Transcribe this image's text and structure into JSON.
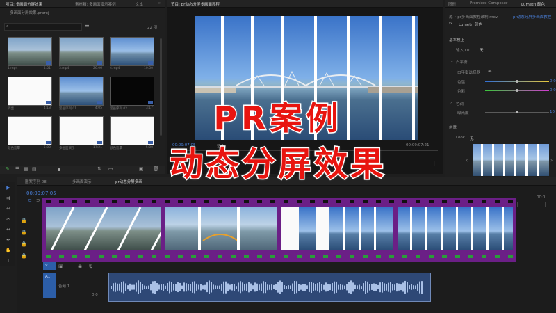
{
  "project_panel": {
    "tabs": [
      "项目: 多画面分屏效果",
      "素材箱: 多画面演示案例",
      "文本"
    ],
    "file_name": "多画面分屏效果.prproj",
    "item_count": "22 项",
    "clips": [
      {
        "label": "1.mp4",
        "duration": "4:01",
        "kind": "city"
      },
      {
        "label": "3.mp4",
        "duration": "26:06",
        "kind": "city"
      },
      {
        "label": "4.mp4",
        "duration": "10:50",
        "kind": "bridge"
      },
      {
        "label": "调出",
        "duration": "4:13",
        "kind": "white"
      },
      {
        "label": "竖画序列 01",
        "duration": "4:05",
        "kind": "bridge"
      },
      {
        "label": "竖画序列 02",
        "duration": "3:17",
        "kind": "black"
      },
      {
        "label": "颜色遮罩",
        "duration": "5:00",
        "kind": "white"
      },
      {
        "label": "多画面演示",
        "duration": "17:21",
        "kind": "white"
      },
      {
        "label": "颜色遮罩",
        "duration": "5:00",
        "kind": "white"
      }
    ]
  },
  "program_monitor": {
    "tab": "节目: pr动态分屏多画面教程",
    "timecode_left": "00:09:07:05",
    "fit_label": "适合",
    "timecode_right": "00:09:07:21"
  },
  "right_panel": {
    "tabs": [
      "图形",
      "Premiere Composer",
      "Lumetri 颜色"
    ],
    "source_line": "源 • pr多画面教程录制.mov",
    "sequence_line": "pr动态分屏多画面教程",
    "effect_name": "Lumetri 颜色",
    "basic_correction": "基本校正",
    "input_lut_label": "输入 LUT",
    "input_lut_value": "无",
    "white_balance": "白平衡",
    "wb_picker": "白平衡选择器",
    "temperature": "色温",
    "tint": "色彩",
    "tone": "色调",
    "exposure": "曝光度",
    "creative": "创意",
    "look_label": "Look",
    "look_value": "无",
    "values": {
      "temperature": "0.0",
      "tint": "0.0",
      "exposure": "10"
    }
  },
  "timeline": {
    "tabs": [
      "图案序列 08",
      "多画面演示",
      "pr动态分屏多画"
    ],
    "timecode": "00:09:07:05",
    "ruler_end": "00:0",
    "tracks": [
      "V1",
      "A1"
    ],
    "track_names": {
      "audio": "音频 1"
    },
    "audio_level": "0.0"
  },
  "overlay": {
    "line1": "PR案例",
    "line2": "动态分屏效果"
  },
  "colors": {
    "film_frame": "#6b1f86",
    "headline": "#e8140f",
    "audio_clip": "#2e4876",
    "accent_blue": "#4a7fd8"
  }
}
